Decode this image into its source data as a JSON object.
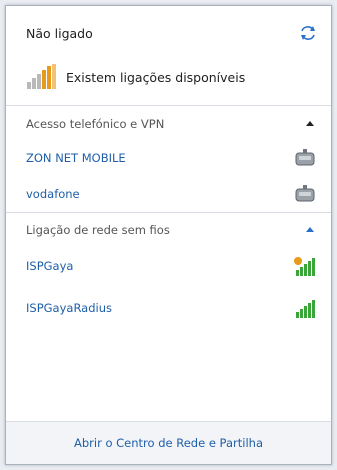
{
  "status": {
    "text": "Não ligado"
  },
  "availability": {
    "text": "Existem ligações disponíveis"
  },
  "dialup_section": {
    "title": "Acesso telefónico e VPN",
    "items": [
      {
        "label": "ZON NET MOBILE",
        "icon": "modem-icon"
      },
      {
        "label": "vodafone",
        "icon": "modem-icon"
      }
    ]
  },
  "wireless_section": {
    "title": "Ligação de rede sem fios",
    "items": [
      {
        "label": "ISPGaya",
        "icon": "wifi-signal-secured-icon"
      },
      {
        "label": "ISPGayaRadius",
        "icon": "wifi-signal-icon"
      }
    ]
  },
  "footer": {
    "link": "Abrir o Centro de Rede e Partilha"
  },
  "colors": {
    "link": "#1f5fa8",
    "signal_green": "#3aa63a",
    "signal_amber": "#e89a1a"
  }
}
